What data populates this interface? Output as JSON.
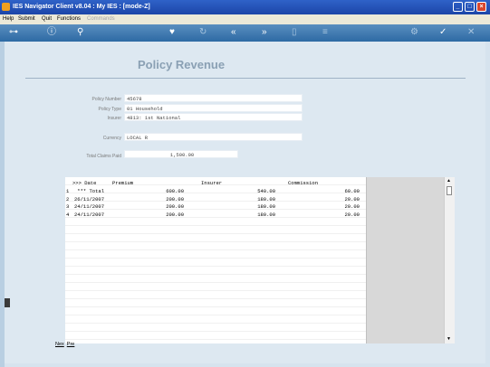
{
  "window": {
    "title": "IES Navigator Client v8.04 : My IES :      [mode-Z]"
  },
  "menu": {
    "items": [
      "Help",
      "Submit",
      "Quit",
      "Functions",
      "Commands"
    ]
  },
  "page": {
    "heading": "Policy Revenue"
  },
  "form": {
    "policy_number": {
      "label": "Policy Number",
      "value": "45678"
    },
    "policy_type": {
      "label": "Policy Type",
      "value": "01 Household"
    },
    "insurer": {
      "label": "Insurer",
      "value": "4813: 1st National"
    },
    "currency": {
      "label": "Currency",
      "value": "LOCAL R"
    },
    "total_claims_paid": {
      "label": "Total Claims Paid",
      "value": "1,500.00"
    }
  },
  "grid": {
    "columns": [
      ">>> Date",
      "Premium",
      "Insurer",
      "Commission"
    ],
    "rows": [
      {
        "num": "1",
        "date": " *** Total",
        "premium": "600.00",
        "insurer": "540.00",
        "commission": "60.00"
      },
      {
        "num": "2",
        "date": "26/11/2007",
        "premium": "200.00",
        "insurer": "180.00",
        "commission": "20.00"
      },
      {
        "num": "3",
        "date": "24/11/2007",
        "premium": "200.00",
        "insurer": "180.00",
        "commission": "20.00"
      },
      {
        "num": "4",
        "date": "24/11/2007",
        "premium": "200.00",
        "insurer": "180.00",
        "commission": "20.00"
      }
    ]
  },
  "footer": {
    "next_label": "Nex",
    "prev_label": "Pre"
  }
}
